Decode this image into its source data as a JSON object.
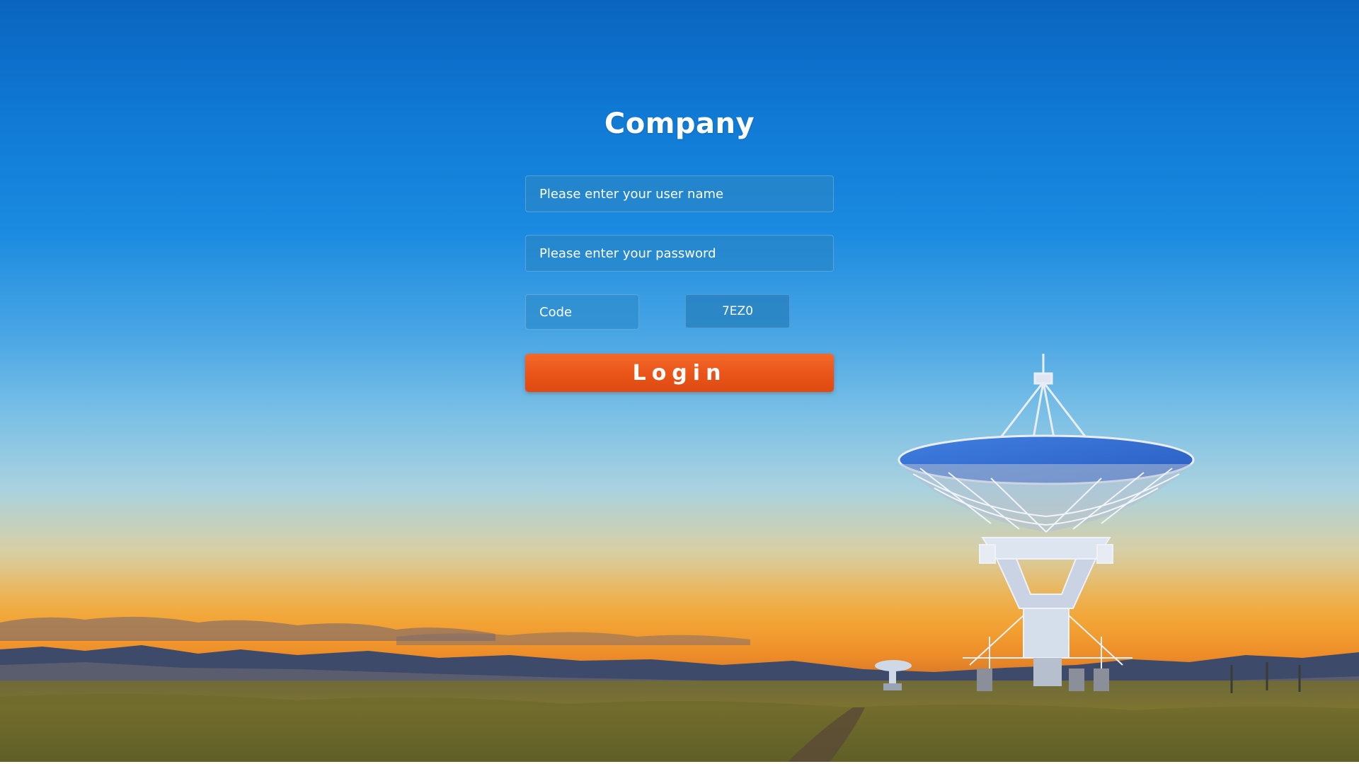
{
  "brand": {
    "title": "Company"
  },
  "form": {
    "username_placeholder": "Please enter your user name",
    "password_placeholder": "Please enter your password",
    "code_placeholder": "Code",
    "captcha_text": "7EZ0",
    "login_label": "Login"
  },
  "colors": {
    "sky_top": "#0a64bf",
    "horizon_glow": "#f2aa3c",
    "field_background": "#2887c8",
    "login_button": "#ea5418",
    "text": "#ffffff"
  }
}
